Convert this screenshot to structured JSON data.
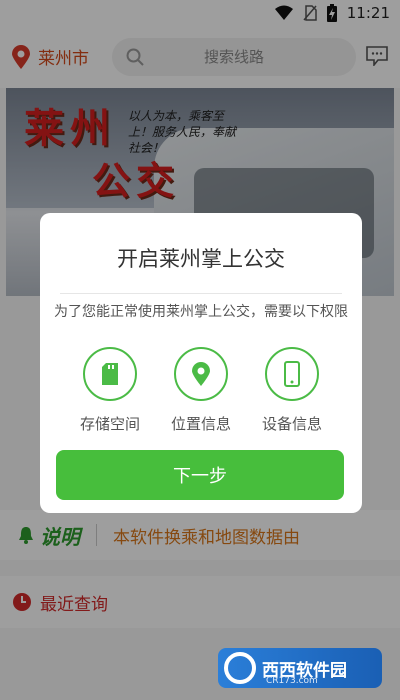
{
  "status": {
    "time": "11:21"
  },
  "header": {
    "city": "莱州市",
    "search_placeholder": "搜索线路"
  },
  "banner": {
    "title_top": "莱州",
    "title_bottom": "公交",
    "slogan": "以人为本，乘客至上！服务人民，奉献社会！"
  },
  "notice": {
    "badge": "说明",
    "text": "本软件换乘和地图数据由"
  },
  "recent": {
    "label": "最近查询"
  },
  "watermark": {
    "name": "西西软件园",
    "url": "CR173.com"
  },
  "dialog": {
    "title": "开启莱州掌上公交",
    "description": "为了您能正常使用莱州掌上公交，需要以下权限",
    "permissions": [
      {
        "label": "存储空间",
        "icon": "sd-card-icon"
      },
      {
        "label": "位置信息",
        "icon": "location-pin-icon"
      },
      {
        "label": "设备信息",
        "icon": "phone-icon"
      }
    ],
    "next_label": "下一步"
  },
  "colors": {
    "accent_green": "#47be3c",
    "city_red": "#d44a1a",
    "notice_orange": "#d9771a"
  }
}
